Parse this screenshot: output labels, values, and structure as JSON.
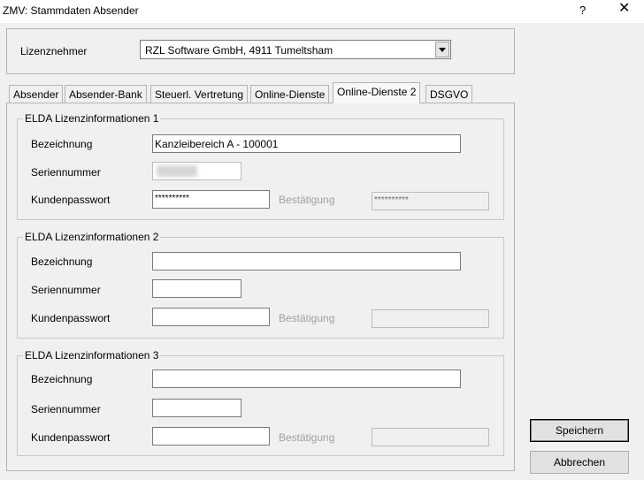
{
  "window": {
    "title": "ZMV: Stammdaten Absender",
    "help_label": "?",
    "close_label": "✕"
  },
  "licensee": {
    "label": "Lizenznehmer",
    "selected_value": "RZL Software GmbH, 4911 Tumeltsham"
  },
  "tabs": [
    {
      "label": "Absender"
    },
    {
      "label": "Absender-Bank"
    },
    {
      "label": "Steuerl. Vertretung"
    },
    {
      "label": "Online-Dienste"
    },
    {
      "label": "Online-Dienste 2"
    },
    {
      "label": "DSGVO"
    }
  ],
  "active_tab": "Online-Dienste 2",
  "labels": {
    "bezeichnung": "Bezeichnung",
    "seriennummer": "Seriennummer",
    "kundenpasswort": "Kundenpasswort",
    "bestaetigung": "Bestätigung"
  },
  "groups": [
    {
      "legend": "ELDA Lizenzinformationen 1",
      "bezeichnung": "Kanzleibereich A - 100001",
      "seriennummer": "",
      "kundenpasswort": "**********",
      "bestaetigung": "**********"
    },
    {
      "legend": "ELDA Lizenzinformationen 2",
      "bezeichnung": "",
      "seriennummer": "",
      "kundenpasswort": "",
      "bestaetigung": ""
    },
    {
      "legend": "ELDA Lizenzinformationen 3",
      "bezeichnung": "",
      "seriennummer": "",
      "kundenpasswort": "",
      "bestaetigung": ""
    }
  ],
  "buttons": {
    "save": "Speichern",
    "cancel": "Abbrechen"
  }
}
